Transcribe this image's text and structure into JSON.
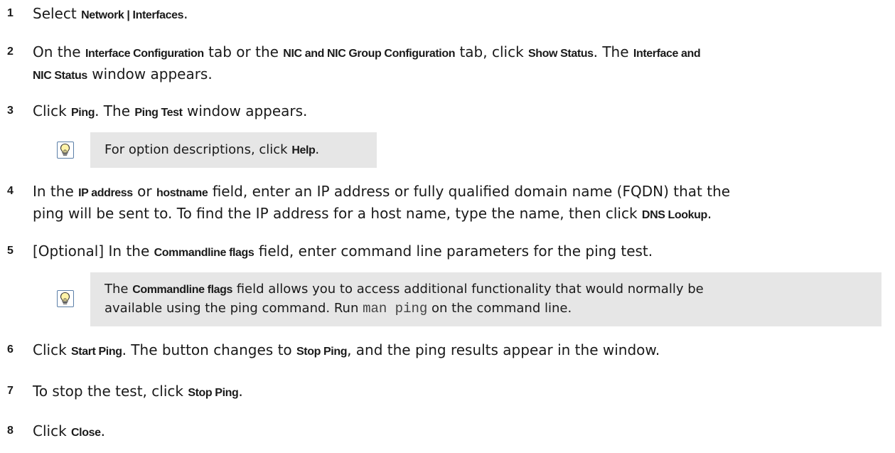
{
  "steps": [
    {
      "num": "1",
      "a": "Select ",
      "b": "Network | Interfaces",
      "c": "."
    },
    {
      "num": "2",
      "a": "On the ",
      "b": "Interface Configuration",
      "c": " tab or the ",
      "d": "NIC and NIC Group Configuration",
      "e": " tab, click ",
      "f": "Show Status",
      "g": ". The ",
      "h": "Interface and",
      "i": "NIC Status",
      "j": " window appears."
    },
    {
      "num": "3",
      "a": "Click ",
      "b": "Ping",
      "c": ". The ",
      "d": "Ping Test",
      "e": " window appears."
    },
    {
      "num": "4",
      "a": "In the ",
      "b": "IP address",
      "c": " or ",
      "d": "hostname",
      "e": " field, enter an IP address or fully qualified domain name (FQDN) that the",
      "f": "ping will be sent to. To find the IP address for a host name, type the name, then click ",
      "g": "DNS Lookup",
      "h": "."
    },
    {
      "num": "5",
      "a": "[Optional] In the ",
      "b": "Commandline flags",
      "c": " field, enter command line parameters for the ping test."
    },
    {
      "num": "6",
      "a": "Click ",
      "b": "Start Ping",
      "c": ". The button changes to ",
      "d": "Stop Ping",
      "e": ", and the ping results appear in the window."
    },
    {
      "num": "7",
      "a": "To stop the test, click ",
      "b": "Stop Ping",
      "c": "."
    },
    {
      "num": "8",
      "a": "Click ",
      "b": "Close",
      "c": "."
    }
  ],
  "tip1": {
    "icon": "lightbulb-icon",
    "a": "For option descriptions, click ",
    "b": "Help",
    "c": "."
  },
  "tip2": {
    "icon": "lightbulb-icon",
    "a": "The ",
    "b": "Commandline flags",
    "c": " field allows you to access additional functionality that would normally be",
    "d": "available using the ping command. Run ",
    "e": "man ping",
    "f": " on the command line."
  },
  "colors": {
    "tip_bg": "#e6e6e6",
    "icon_border": "#5b7fa8",
    "bulb_fill": "#fff3a8"
  }
}
